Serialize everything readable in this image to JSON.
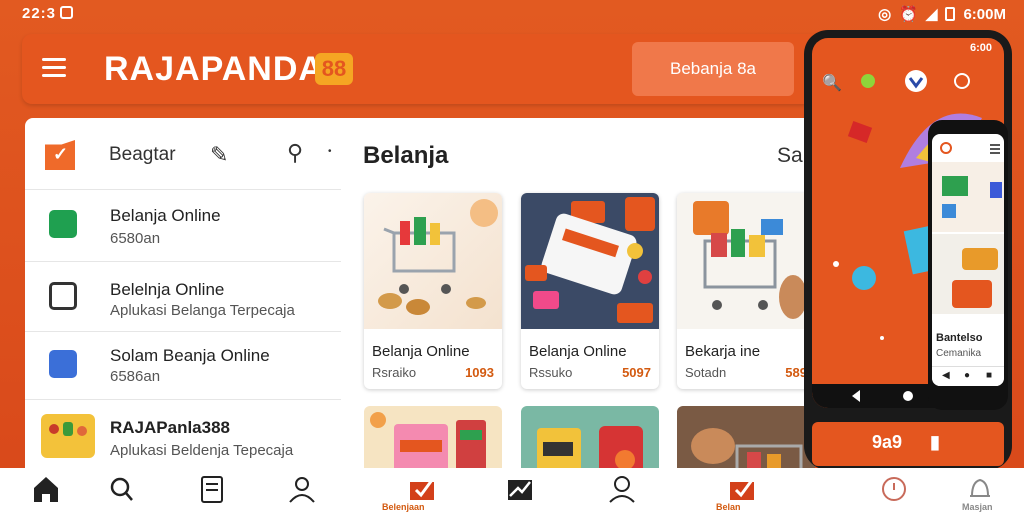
{
  "status": {
    "time": "22:3",
    "right_time": "6:00M"
  },
  "appbar": {
    "brand": "RAJAPANDA",
    "brand_badge": "88",
    "cta_label": "Bebanja 8a"
  },
  "left_panel": {
    "title": "Beagtar",
    "items": [
      {
        "title": "Belanja Online",
        "subtitle": "6580an"
      },
      {
        "title": "Belelnja Online",
        "subtitle": "Aplukasi Belanga Terpecaja"
      },
      {
        "title": "Solam Beanja Online",
        "subtitle": "6586an"
      },
      {
        "title": "RAJAPanla388",
        "subtitle": "Aplukasi Beldenja Tepecaja"
      }
    ]
  },
  "main": {
    "title": "Belanja",
    "see_all": "Sa",
    "cards": [
      {
        "name": "Belanja Online",
        "sub": "Rsraiko",
        "price": "1093"
      },
      {
        "name": "Belanja Online",
        "sub": "Rssuko",
        "price": "5097"
      },
      {
        "name": "Bekarja  ine",
        "sub": "Sotadn",
        "price": "589"
      }
    ]
  },
  "phone": {
    "status": "6:00",
    "inner_title": "Bantelso",
    "inner_sub": "Cemanika",
    "nav_left": "9a9"
  },
  "bottom_nav": {
    "label_1": "Belenjaan",
    "label_2": "Belan",
    "label_3": "Masjan"
  },
  "colors": {
    "brand": "#e4561f",
    "accent": "#f5a623"
  }
}
